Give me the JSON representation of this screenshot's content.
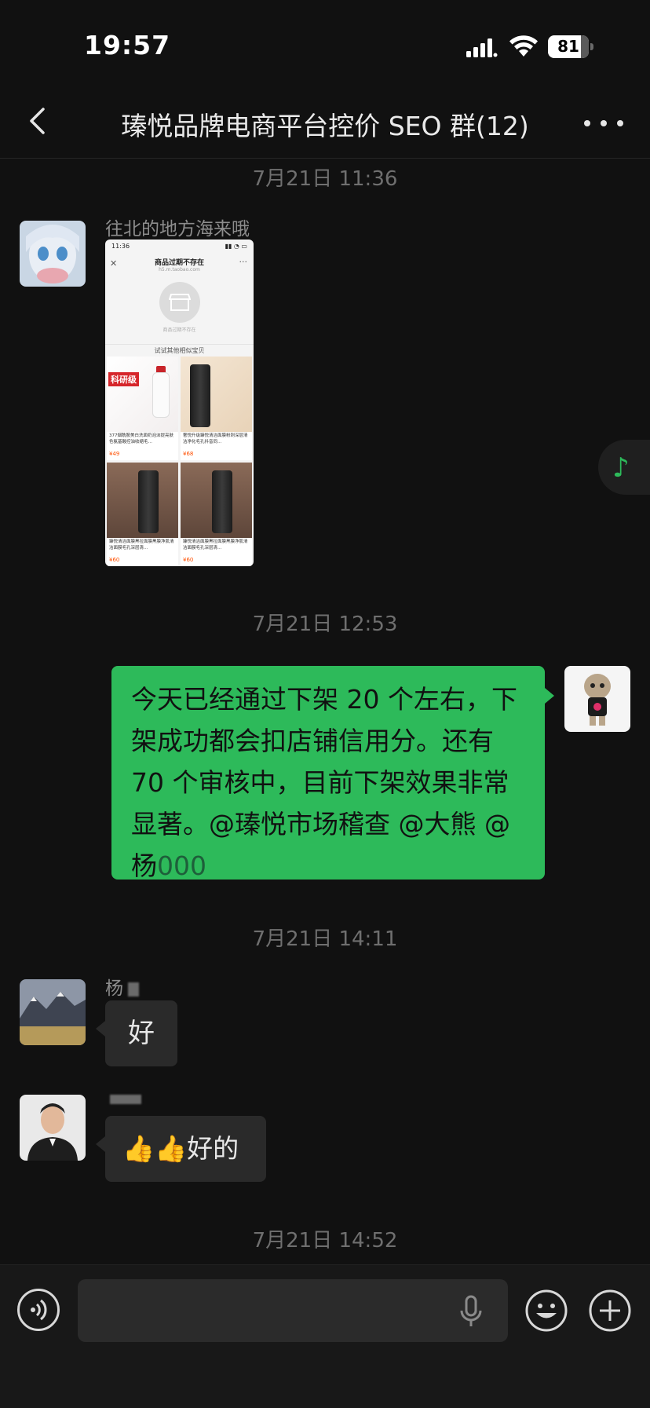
{
  "status_bar": {
    "time": "19:57",
    "battery_percent": "81"
  },
  "nav": {
    "title": "瑧悦品牌电商平台控价 SEO 群(12)"
  },
  "messages": {
    "ts1": "7月21日 11:36",
    "msg1": {
      "sender": "往北的地方海来哦"
    },
    "ts2": "7月21日 12:53",
    "msg2": {
      "text": "今天已经通过下架 20 个左右，下架成功都会扣店铺信用分。还有 70 个审核中，目前下架效果非常显著。@瑧悦市场稽查 @大熊 @杨",
      "text_tail": "000"
    },
    "ts3": "7月21日 14:11",
    "msg3": {
      "sender": "杨",
      "text": "好"
    },
    "msg4": {
      "sender": "",
      "text": "👍👍好的"
    },
    "ts4": "7月21日 14:52"
  },
  "image_message": {
    "status_time": "11:36",
    "page_title": "商品过期不存在",
    "page_url": "h5.m.taobao.com",
    "notice": "商品过期不存在",
    "similar_label": "试试其他相似宝贝",
    "products": [
      {
        "caption": "377烟酰胺美白洗面奶泡沫提亮肤色氨基酸控油收缩毛…",
        "price": "¥49",
        "badge": "科研级"
      },
      {
        "caption": "奢悦升级臻悦清洁面膜粉刺深层清洁净化毛孔抖音同…",
        "price": "¥68",
        "badge": ""
      },
      {
        "caption": "臻悦清洁面膜黑拉面膜黑膜净肌清洁面膜毛孔深层清…",
        "price": "¥60",
        "badge": ""
      },
      {
        "caption": "臻悦清洁面膜黑拉面膜黑膜净肌清洁面膜毛孔深层清…",
        "price": "¥60",
        "badge": ""
      }
    ]
  },
  "input": {
    "placeholder": ""
  },
  "icons": {
    "back": "chevron-left-icon",
    "more": "more-dots-icon",
    "music": "music-note-icon",
    "voice": "voice-icon",
    "mic": "microphone-icon",
    "emoji": "emoji-icon",
    "plus": "plus-icon"
  },
  "colors": {
    "background": "#111111",
    "bubble_out": "#2dba5a",
    "bubble_in": "#2a2a2a",
    "accent": "#2dba5a"
  }
}
